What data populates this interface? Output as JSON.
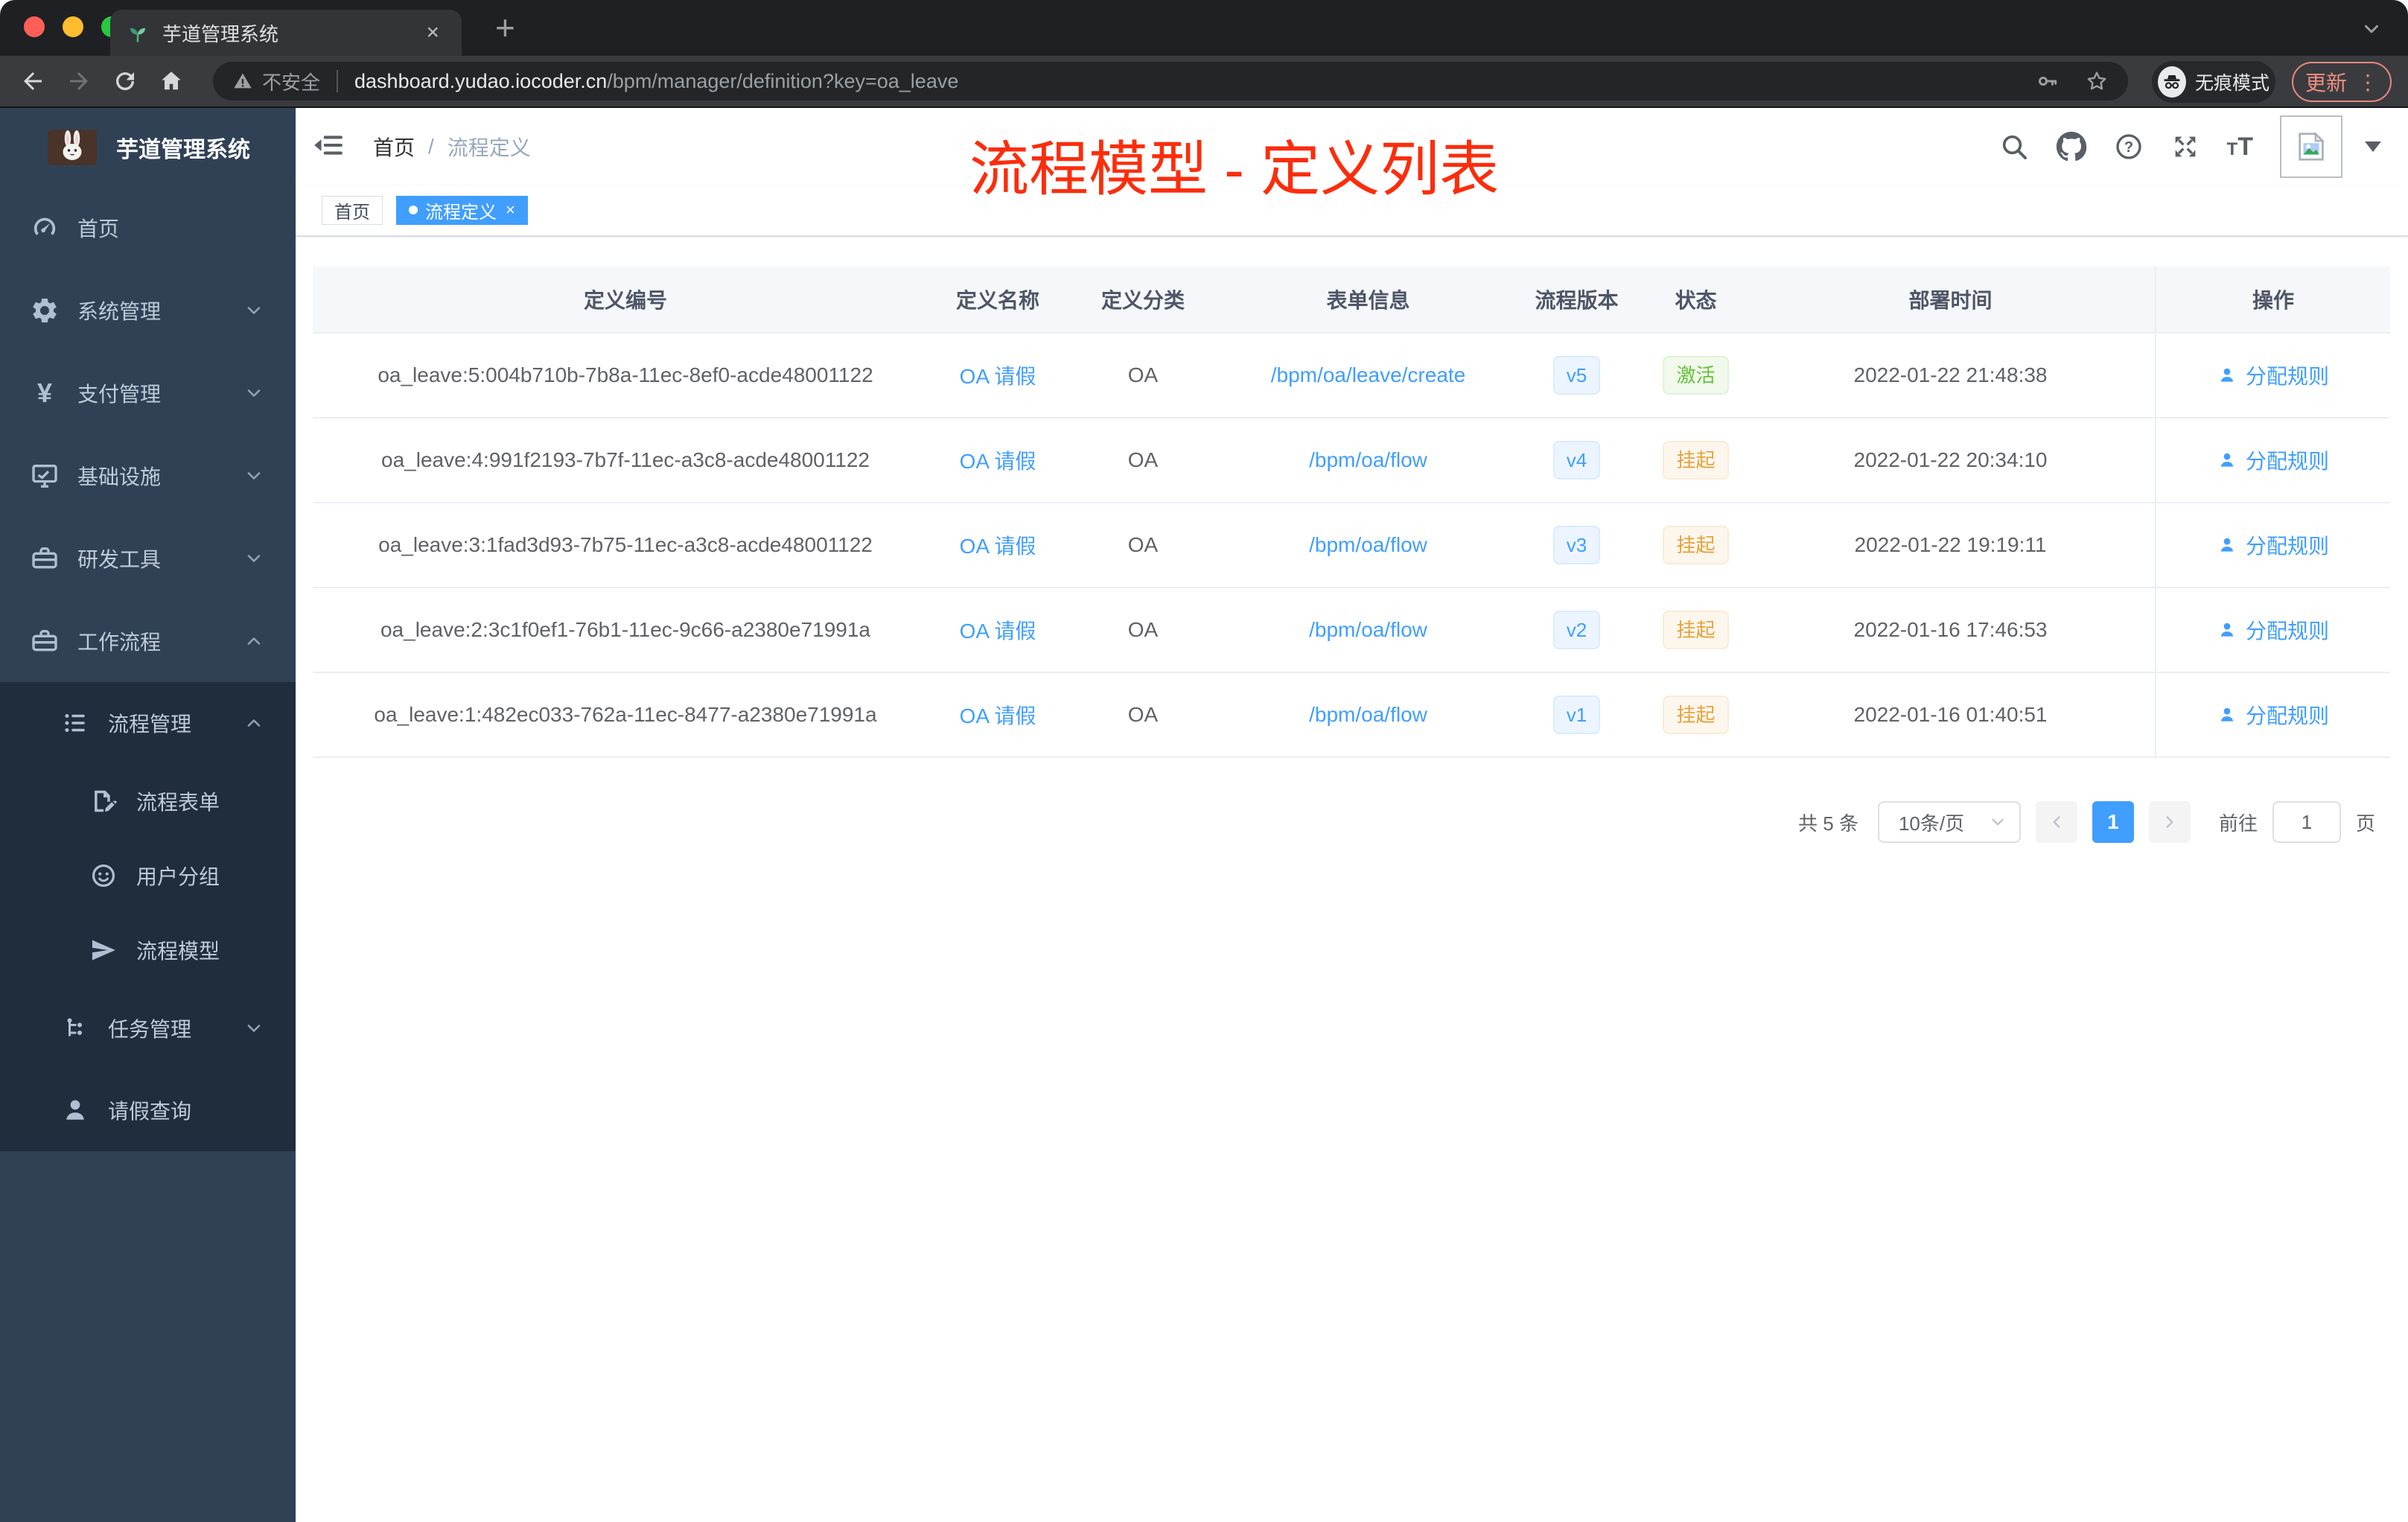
{
  "browser": {
    "tab_title": "芋道管理系统",
    "security_label": "不安全",
    "url_domain": "dashboard.yudao.iocoder.cn",
    "url_path": "/bpm/manager/definition?key=oa_leave",
    "incognito_label": "无痕模式",
    "update_label": "更新"
  },
  "glyphs": {
    "close": "×",
    "plus": "+",
    "kebab": "⋮",
    "qmark": "?",
    "yen": "¥",
    "font_resize": "TT"
  },
  "sidebar": {
    "app_title": "芋道管理系统",
    "items": [
      {
        "label": "首页"
      },
      {
        "label": "系统管理"
      },
      {
        "label": "支付管理"
      },
      {
        "label": "基础设施"
      },
      {
        "label": "研发工具"
      },
      {
        "label": "工作流程"
      },
      {
        "label": "流程管理"
      },
      {
        "label": "流程表单"
      },
      {
        "label": "用户分组"
      },
      {
        "label": "流程模型"
      },
      {
        "label": "任务管理"
      },
      {
        "label": "请假查询"
      }
    ]
  },
  "navbar": {
    "breadcrumb": {
      "home": "首页",
      "sep": "/",
      "current": "流程定义"
    },
    "annotation": "流程模型 - 定义列表"
  },
  "tags": {
    "home": "首页",
    "active": "流程定义"
  },
  "table": {
    "columns": [
      "定义编号",
      "定义名称",
      "定义分类",
      "表单信息",
      "流程版本",
      "状态",
      "部署时间",
      "操作"
    ],
    "action_label": "分配规则",
    "rows": [
      {
        "id": "oa_leave:5:004b710b-7b8a-11ec-8ef0-acde48001122",
        "name": "OA 请假",
        "category": "OA",
        "form": "/bpm/oa/leave/create",
        "version": "v5",
        "status": "激活",
        "time": "2022-01-22 21:48:38"
      },
      {
        "id": "oa_leave:4:991f2193-7b7f-11ec-a3c8-acde48001122",
        "name": "OA 请假",
        "category": "OA",
        "form": "/bpm/oa/flow",
        "version": "v4",
        "status": "挂起",
        "time": "2022-01-22 20:34:10"
      },
      {
        "id": "oa_leave:3:1fad3d93-7b75-11ec-a3c8-acde48001122",
        "name": "OA 请假",
        "category": "OA",
        "form": "/bpm/oa/flow",
        "version": "v3",
        "status": "挂起",
        "time": "2022-01-22 19:19:11"
      },
      {
        "id": "oa_leave:2:3c1f0ef1-76b1-11ec-9c66-a2380e71991a",
        "name": "OA 请假",
        "category": "OA",
        "form": "/bpm/oa/flow",
        "version": "v2",
        "status": "挂起",
        "time": "2022-01-16 17:46:53"
      },
      {
        "id": "oa_leave:1:482ec033-762a-11ec-8477-a2380e71991a",
        "name": "OA 请假",
        "category": "OA",
        "form": "/bpm/oa/flow",
        "version": "v1",
        "status": "挂起",
        "time": "2022-01-16 01:40:51"
      }
    ]
  },
  "pagination": {
    "total": "共 5 条",
    "page_size": "10条/页",
    "page": "1",
    "goto": "前往",
    "goto_value": "1",
    "unit": "页"
  },
  "colors": {
    "accent": "#409eff",
    "success": "#67c23a",
    "warning": "#e6a23c",
    "annotation": "#fb2d0c",
    "sidebar_bg": "#304156",
    "submenu_bg": "#1f2d3d"
  }
}
